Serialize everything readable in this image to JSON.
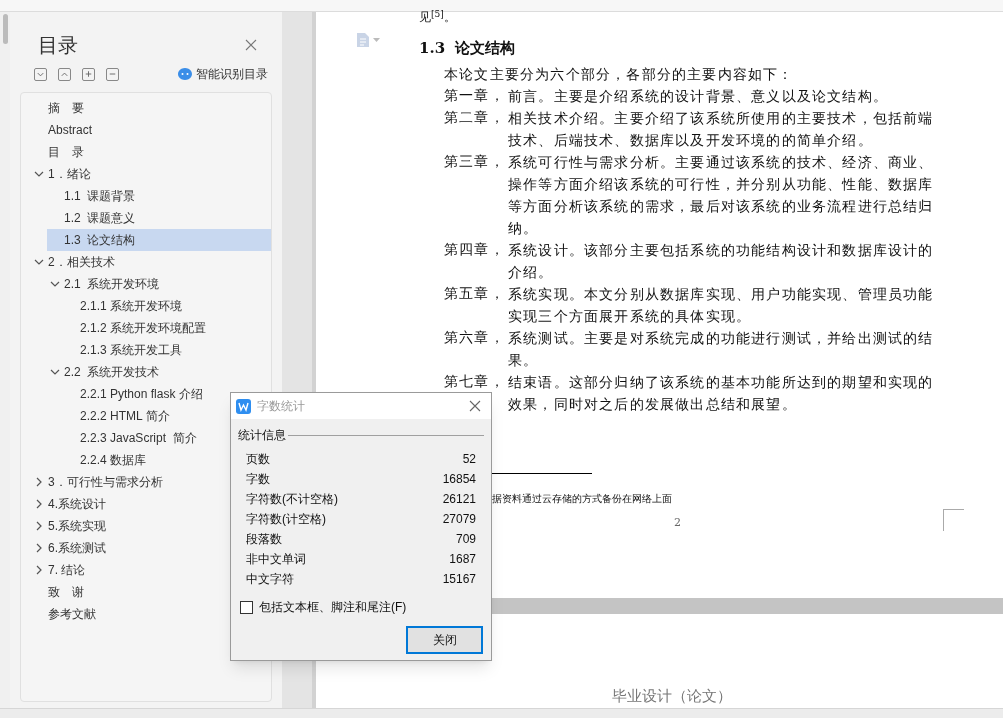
{
  "toc_panel": {
    "title": "目录",
    "smart_button": "智能识别目录",
    "items": [
      {
        "label": "摘　要",
        "selected": false
      },
      {
        "label": "Abstract",
        "selected": false
      },
      {
        "label": "目　录",
        "selected": false
      },
      {
        "label": "1．绪论",
        "selected": false,
        "expanded": true,
        "children": [
          {
            "label": "1.1  课题背景",
            "selected": false
          },
          {
            "label": "1.2  课题意义",
            "selected": false
          },
          {
            "label": "1.3  论文结构",
            "selected": true
          }
        ]
      },
      {
        "label": "2．相关技术",
        "selected": false,
        "expanded": true,
        "children": [
          {
            "label": "2.1  系统开发环境",
            "selected": false,
            "expanded": true,
            "children": [
              {
                "label": "2.1.1 系统开发环境",
                "selected": false
              },
              {
                "label": "2.1.2 系统开发环境配置",
                "selected": false
              },
              {
                "label": "2.1.3 系统开发工具",
                "selected": false
              }
            ]
          },
          {
            "label": "2.2  系统开发技术",
            "selected": false,
            "expanded": true,
            "children": [
              {
                "label": "2.2.1 Python flask 介绍",
                "selected": false
              },
              {
                "label": "2.2.2 HTML 简介",
                "selected": false
              },
              {
                "label": "2.2.3 JavaScript  简介",
                "selected": false
              },
              {
                "label": "2.2.4 数据库",
                "selected": false
              }
            ]
          }
        ]
      },
      {
        "label": "3．可行性与需求分析",
        "selected": false,
        "expanded": false
      },
      {
        "label": "4.系统设计",
        "selected": false,
        "expanded": false
      },
      {
        "label": "5.系统实现",
        "selected": false,
        "expanded": false
      },
      {
        "label": "6.系统测试",
        "selected": false,
        "expanded": false
      },
      {
        "label": "7. 结论",
        "selected": false,
        "expanded": false
      },
      {
        "label": "致　谢",
        "selected": false
      },
      {
        "label": "参考文献",
        "selected": false
      }
    ]
  },
  "document": {
    "top_line": "见$^{[5]}$。",
    "heading_number": "1.3",
    "heading": "论文结构",
    "intro": "本论文主要分为六个部分，各部分的主要内容如下：",
    "chapters": [
      {
        "label": "第一章，",
        "text": "前言。主要是介绍系统的设计背景、意义以及论文结构。"
      },
      {
        "label": "第二章，",
        "text": "相关技术介绍。主要介绍了该系统所使用的主要技术，包括前端技术、后端技术、数据库以及开发环境的的简单介绍。"
      },
      {
        "label": "第三章，",
        "text": "系统可行性与需求分析。主要通过该系统的技术、经济、商业、操作等方面介绍该系统的可行性，并分别从功能、性能、数据库等方面分析该系统的需求，最后对该系统的业务流程进行总结归纳。"
      },
      {
        "label": "第四章，",
        "text": "系统设计。该部分主要包括系统的功能结构设计和数据库设计的介绍。"
      },
      {
        "label": "第五章，",
        "text": "系统实现。本文分别从数据库实现、用户功能实现、管理员功能实现三个方面展开系统的具体实现。"
      },
      {
        "label": "第六章，",
        "text": "系统测试。主要是对系统完成的功能进行测试，并给出测试的结果。"
      },
      {
        "label": "第七章，",
        "text": "结束语。这部分归纳了该系统的基本功能所达到的期望和实现的效果，同时对之后的发展做出总结和展望。"
      }
    ],
    "footnote": "据资料通过云存储的方式备份在网络上面",
    "page_number": "2",
    "next_page_heading": "毕业设计（论文）"
  },
  "dialog": {
    "title": "字数统计",
    "group": "统计信息",
    "stats": [
      {
        "label": "页数",
        "value": "52"
      },
      {
        "label": "字数",
        "value": "16854"
      },
      {
        "label": "字符数(不计空格)",
        "value": "26121"
      },
      {
        "label": "字符数(计空格)",
        "value": "27079"
      },
      {
        "label": "段落数",
        "value": "709"
      },
      {
        "label": "非中文单词",
        "value": "1687"
      },
      {
        "label": "中文字符",
        "value": "15167"
      }
    ],
    "checkbox": {
      "label": "包括文本框、脚注和尾注(F)",
      "checked": false
    },
    "close_button": "关闭"
  }
}
